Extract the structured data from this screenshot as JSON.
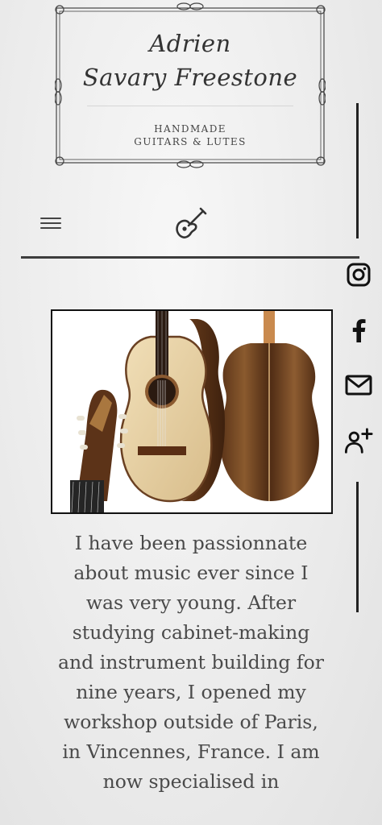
{
  "logo": {
    "name_line1": "Adrien",
    "name_line2": "Savary Freestone",
    "tagline_line1": "HANDMADE",
    "tagline_line2": "GUITARS & LUTES"
  },
  "nav": {
    "menu_icon": "hamburger-menu-icon",
    "home_icon": "guitar-icon"
  },
  "social": {
    "icons": [
      "instagram-icon",
      "facebook-icon",
      "mail-icon",
      "add-user-icon"
    ]
  },
  "intro": {
    "text": "I have been passionnate about music ever since I was very young. After studying cabinet-making and instrument building for nine years, I opened my workshop outside of Paris, in Vincennes, France. I am now specialised in"
  },
  "colors": {
    "text": "#4a4a4a",
    "rules": "#3d3d3d",
    "background": "#ececec"
  }
}
